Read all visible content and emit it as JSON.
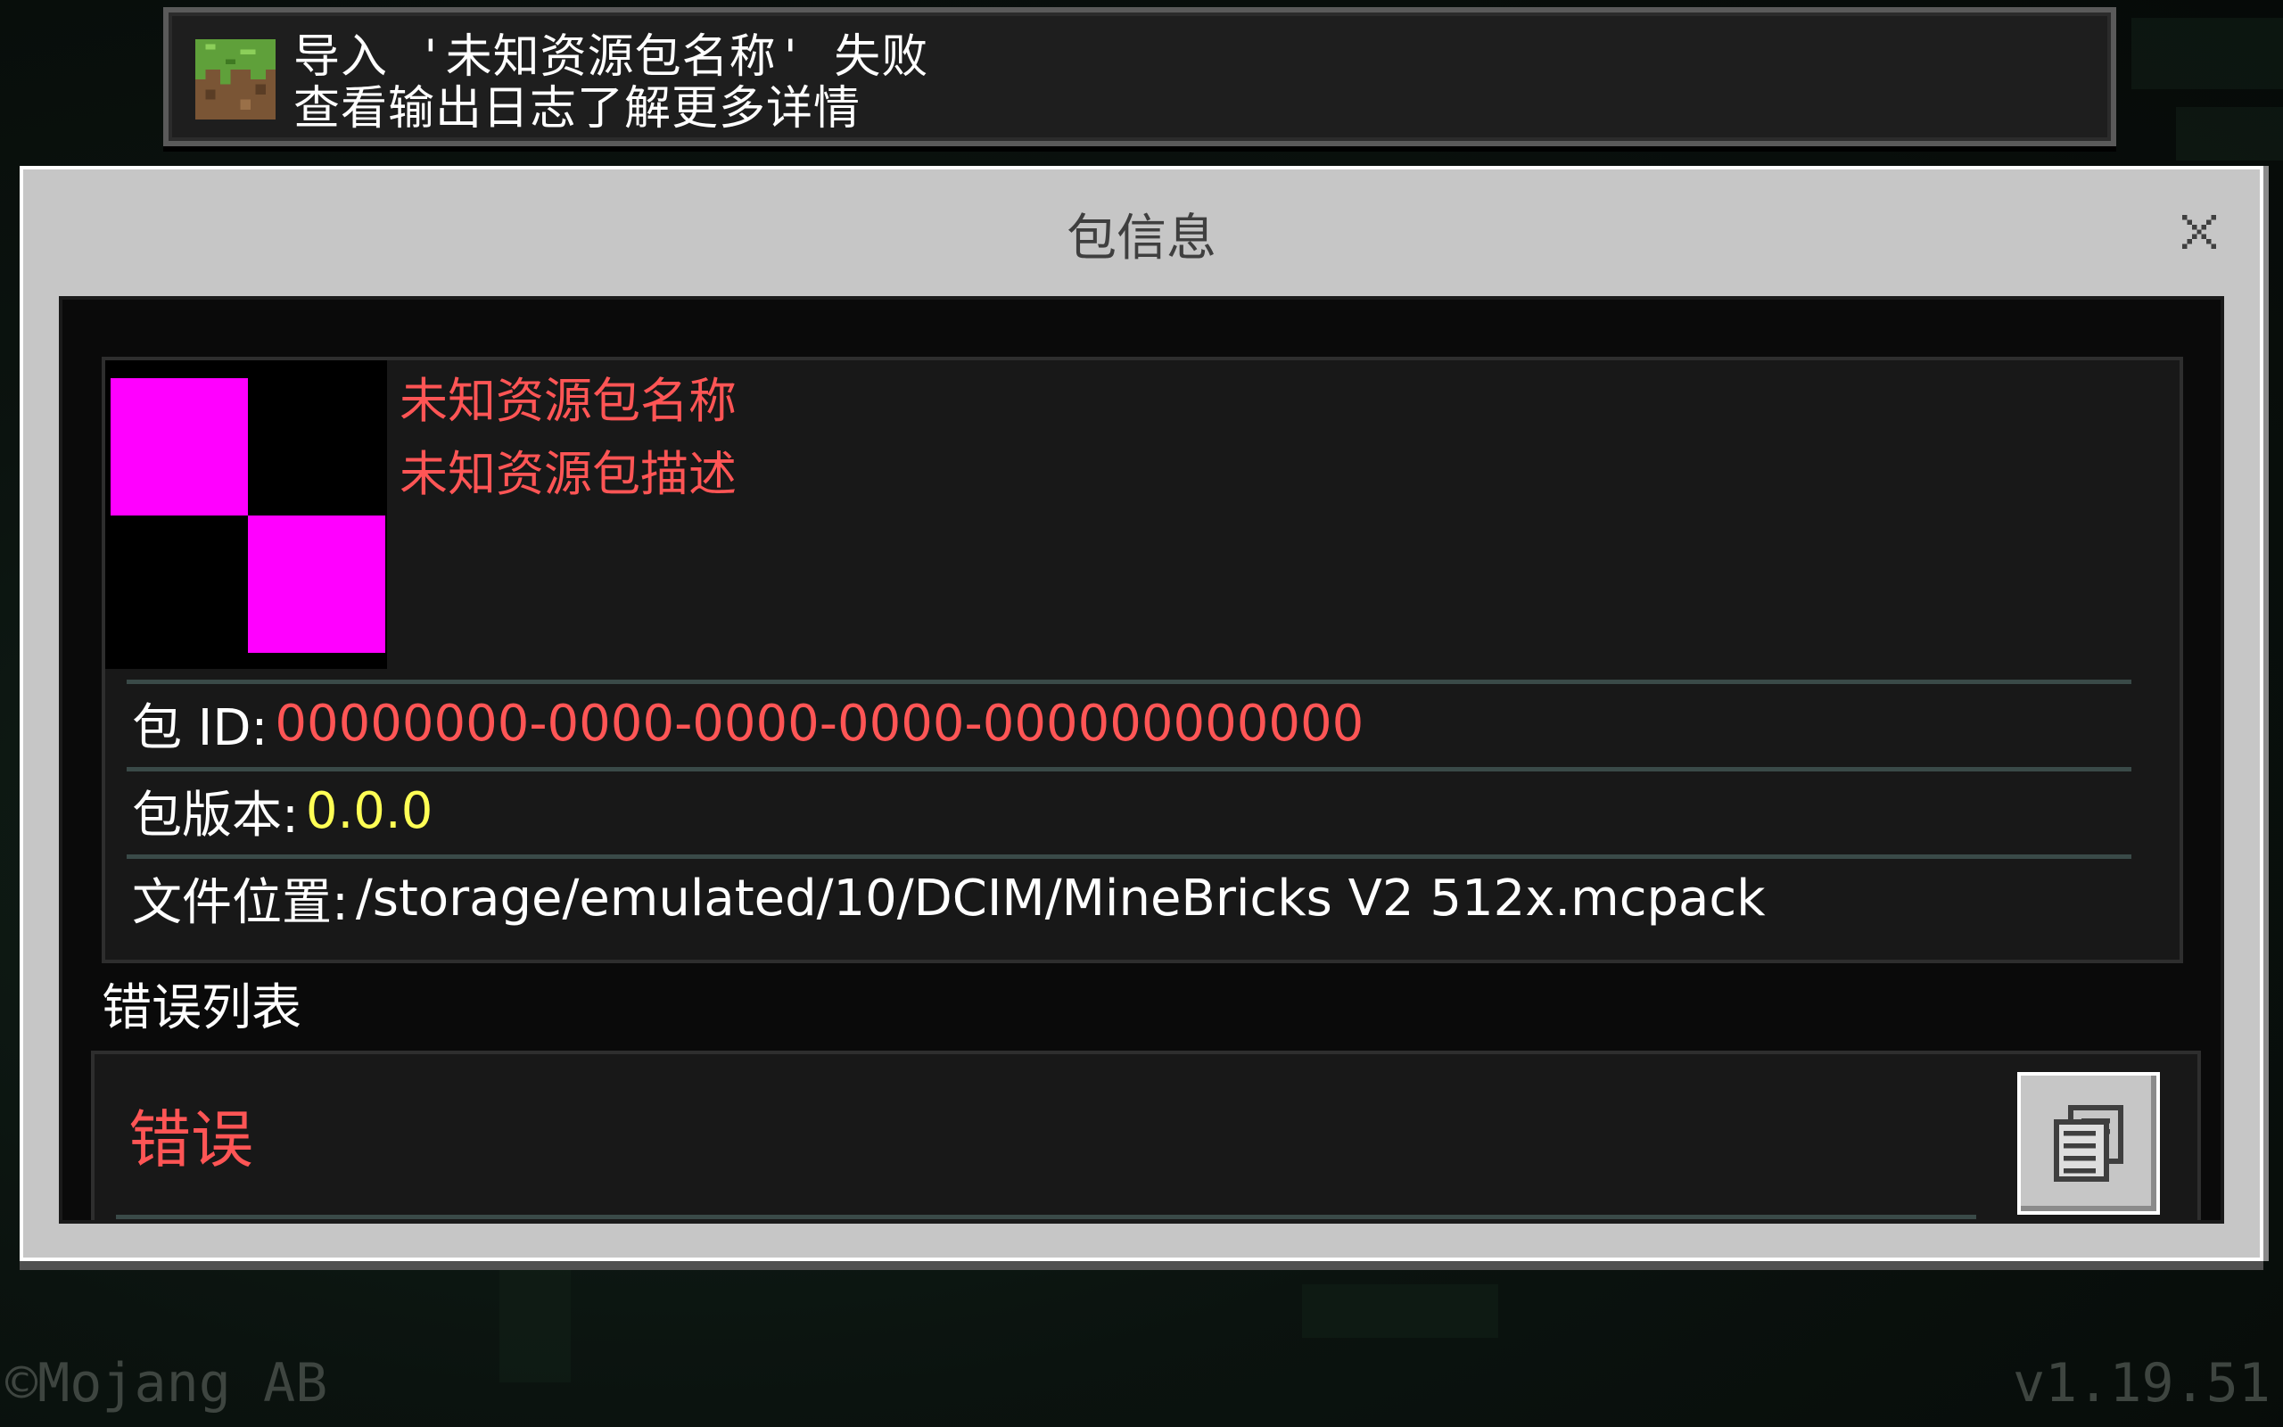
{
  "toast": {
    "line1": "导入 '未知资源包名称' 失败",
    "line2": "查看输出日志了解更多详情",
    "icon": "grass-block-icon"
  },
  "dialog": {
    "title": "包信息",
    "close_icon": "close-icon"
  },
  "pack": {
    "name": "未知资源包名称",
    "description": "未知资源包描述",
    "icon": "missing-texture-icon",
    "fields": {
      "id_label": "包 ID:",
      "id_value": "00000000-0000-0000-0000-000000000000",
      "version_label": "包版本:",
      "version_value": "0.0.0",
      "location_label": "文件位置:",
      "location_value": "/storage/emulated/10/DCIM/MineBricks V2 512x.mcpack"
    }
  },
  "errors": {
    "heading": "错误列表",
    "items": [
      {
        "title": "错误"
      }
    ],
    "copy_icon": "copy-clipboard-icon"
  },
  "footer": {
    "copyright": "©Mojang AB",
    "version": "v1.19.51"
  },
  "colors": {
    "error_red": "#ff5555",
    "version_yellow": "#ffff55",
    "panel_gray": "#c6c6c6",
    "content_dark": "#0a0a0a"
  }
}
